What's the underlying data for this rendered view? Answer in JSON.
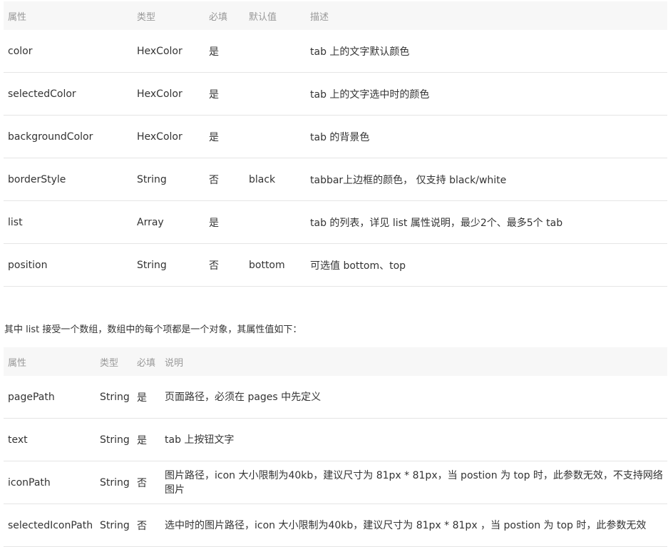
{
  "table1": {
    "headers": [
      "属性",
      "类型",
      "必填",
      "默认值",
      "描述"
    ],
    "rows": [
      [
        "color",
        "HexColor",
        "是",
        "",
        "tab 上的文字默认颜色"
      ],
      [
        "selectedColor",
        "HexColor",
        "是",
        "",
        "tab 上的文字选中时的颜色"
      ],
      [
        "backgroundColor",
        "HexColor",
        "是",
        "",
        "tab 的背景色"
      ],
      [
        "borderStyle",
        "String",
        "否",
        "black",
        "tabbar上边框的颜色， 仅支持 black/white"
      ],
      [
        "list",
        "Array",
        "是",
        "",
        "tab 的列表，详见 list 属性说明，最少2个、最多5个 tab"
      ],
      [
        "position",
        "String",
        "否",
        "bottom",
        "可选值 bottom、top"
      ]
    ]
  },
  "note": "其中 list 接受一个数组，数组中的每个项都是一个对象，其属性值如下：",
  "table2": {
    "headers": [
      "属性",
      "类型",
      "必填",
      "说明"
    ],
    "rows": [
      [
        "pagePath",
        "String",
        "是",
        "页面路径，必须在 pages 中先定义"
      ],
      [
        "text",
        "String",
        "是",
        "tab 上按钮文字"
      ],
      [
        "iconPath",
        "String",
        "否",
        "图片路径，icon 大小限制为40kb，建议尺寸为 81px * 81px，当 postion 为 top 时，此参数无效，不支持网络图片"
      ],
      [
        "selectedIconPath",
        "String",
        "否",
        "选中时的图片路径，icon 大小限制为40kb，建议尺寸为 81px * 81px ，当 postion 为 top 时，此参数无效"
      ]
    ]
  }
}
